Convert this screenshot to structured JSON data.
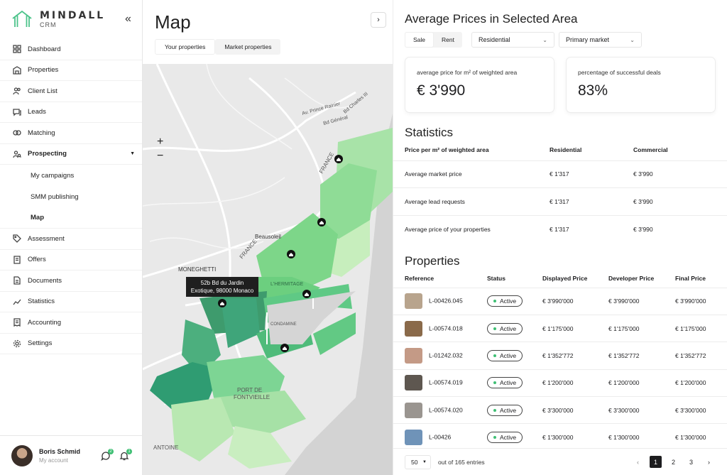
{
  "brand": {
    "name": "MINDALL",
    "sub": "CRM"
  },
  "nav": {
    "items": [
      {
        "label": "Dashboard",
        "icon": "dashboard-icon"
      },
      {
        "label": "Properties",
        "icon": "building-icon"
      },
      {
        "label": "Client List",
        "icon": "users-icon"
      },
      {
        "label": "Leads",
        "icon": "chat-icon"
      },
      {
        "label": "Matching",
        "icon": "link-icon"
      },
      {
        "label": "Prospecting",
        "icon": "prospecting-icon"
      }
    ],
    "sub": [
      "My campaigns",
      "SMM publishing",
      "Map"
    ],
    "items2": [
      {
        "label": "Assessment",
        "icon": "tag-icon"
      },
      {
        "label": "Offers",
        "icon": "offer-icon"
      },
      {
        "label": "Documents",
        "icon": "document-icon"
      },
      {
        "label": "Statistics",
        "icon": "chart-icon"
      },
      {
        "label": "Accounting",
        "icon": "receipt-icon"
      },
      {
        "label": "Settings",
        "icon": "gear-icon"
      }
    ]
  },
  "user": {
    "name": "Boris Schmid",
    "role": "My account",
    "messages_badge": "2",
    "notifications_badge": "1"
  },
  "map": {
    "title": "Map",
    "tabs": [
      "Your properties",
      "Market properties"
    ],
    "zoom_in": "+",
    "zoom_out": "−",
    "tooltip_line1": "52b Bd du Jardin",
    "tooltip_line2": "Exotique, 98000 Monaco",
    "labels": [
      "Av. Prince Rainier",
      "Bd Général",
      "Bd Charles III",
      "FRANCE",
      "Beausoleil",
      "MONEGHETTI",
      "FRANCE",
      "PORT DE",
      "FONTVIEILLE",
      "ANTOINE",
      "L'HERMITAGE",
      "CONDAMINE"
    ]
  },
  "panel": {
    "title": "Average Prices in Selected Area",
    "seg": [
      "Sale",
      "Rent"
    ],
    "type_select": "Residential",
    "market_select": "Primary market",
    "cards": [
      {
        "label": "average price for m² of weighted area",
        "value": "€ 3'990"
      },
      {
        "label": "percentage of successful deals",
        "value": "83%"
      }
    ],
    "stats_title": "Statistics",
    "stats_headers": [
      "Price per m² of weighted area",
      "Residential",
      "Commercial"
    ],
    "stats_rows": [
      [
        "Average market price",
        "€ 1'317",
        "€ 3'990"
      ],
      [
        "Average lead requests",
        "€ 1'317",
        "€ 3'990"
      ],
      [
        "Average price of your properties",
        "€ 1'317",
        "€ 3'990"
      ]
    ],
    "props_title": "Properties",
    "props_headers": [
      "Reference",
      "Status",
      "Displayed Price",
      "Developer Price",
      "Final Price"
    ],
    "props_rows": [
      {
        "ref": "L-00426.045",
        "status": "Active",
        "displayed": "€ 3'990'000",
        "developer": "€ 3'990'000",
        "final": "€ 3'990'000",
        "thumb": "#b8a48d"
      },
      {
        "ref": "L-00574.018",
        "status": "Active",
        "displayed": "€ 1'175'000",
        "developer": "€ 1'175'000",
        "final": "€ 1'175'000",
        "thumb": "#8a6a4a"
      },
      {
        "ref": "L-01242.032",
        "status": "Active",
        "displayed": "€ 1'352'772",
        "developer": "€ 1'352'772",
        "final": "€ 1'352'772",
        "thumb": "#c49a86"
      },
      {
        "ref": "L-00574.019",
        "status": "Active",
        "displayed": "€ 1'200'000",
        "developer": "€ 1'200'000",
        "final": "€ 1'200'000",
        "thumb": "#5e5750"
      },
      {
        "ref": "L-00574.020",
        "status": "Active",
        "displayed": "€ 3'300'000",
        "developer": "€ 3'300'000",
        "final": "€ 3'300'000",
        "thumb": "#9a9590"
      },
      {
        "ref": "L-00426",
        "status": "Active",
        "displayed": "€ 1'300'000",
        "developer": "€ 1'300'000",
        "final": "€ 1'300'000",
        "thumb": "#6f93b8"
      }
    ],
    "per_page": "50",
    "entries_text": "out of 165 entries",
    "pages": [
      "1",
      "2",
      "3"
    ],
    "prev": "‹",
    "next": "›"
  },
  "colors": {
    "accent_green": "#3fbf74",
    "dark": "#1d1d1f"
  }
}
